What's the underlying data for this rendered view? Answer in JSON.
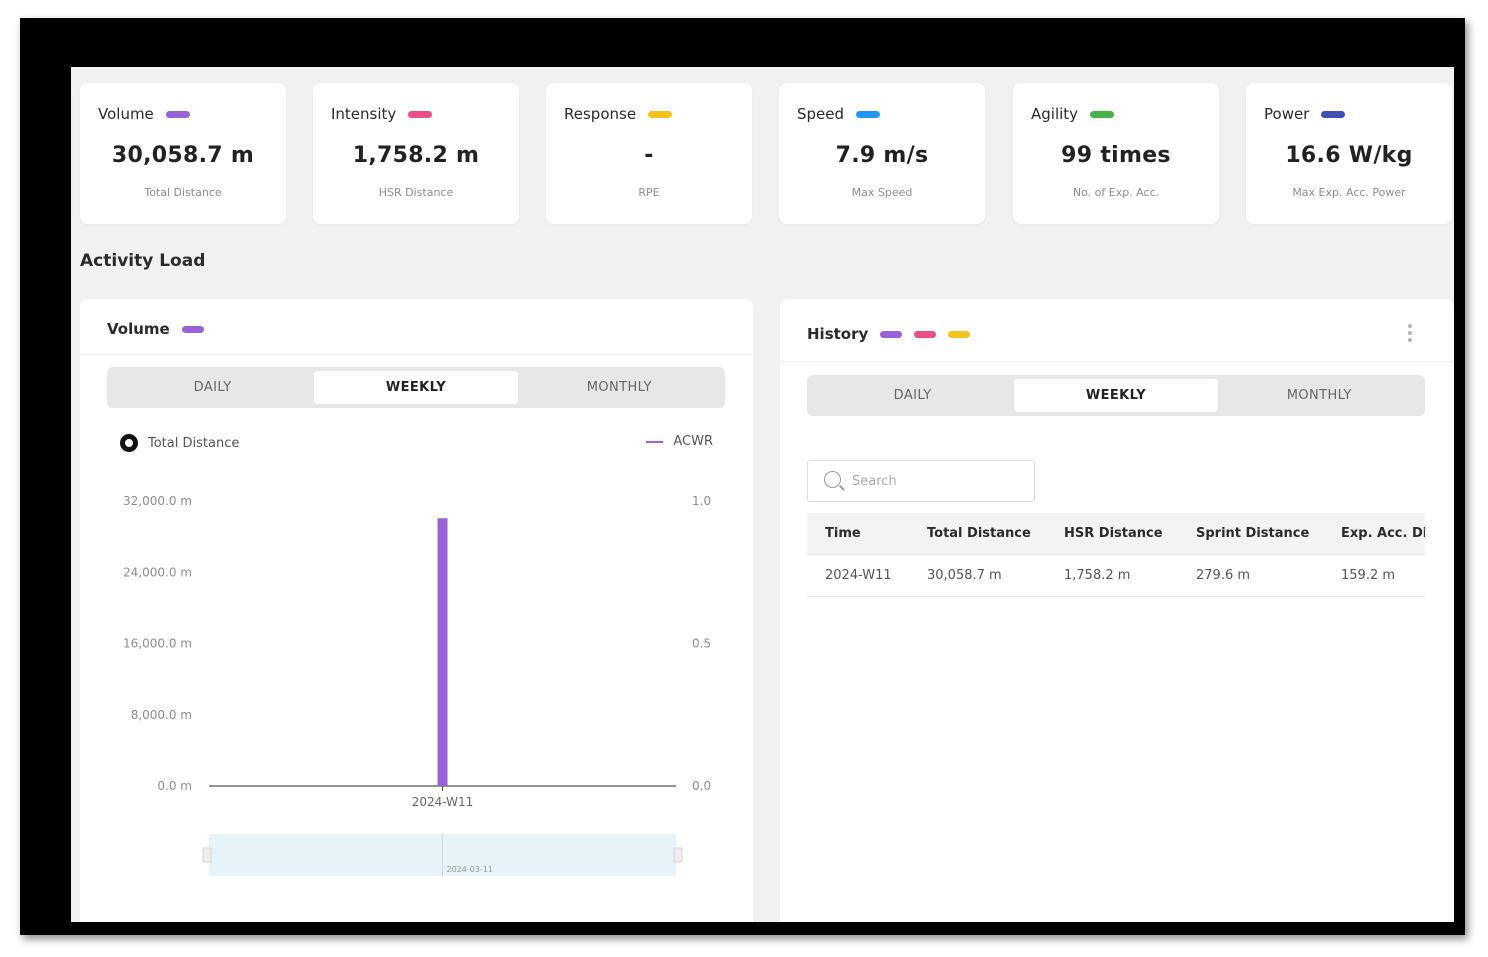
{
  "colors": {
    "volume": "#9a62d8",
    "intensity": "#ea4f8a",
    "response": "#f3c21b",
    "speed": "#2196f3",
    "agility": "#43b34a",
    "power": "#3f51b5"
  },
  "cards": [
    {
      "title": "Volume",
      "value": "30,058.7 m",
      "sub": "Total Distance",
      "color_key": "volume"
    },
    {
      "title": "Intensity",
      "value": "1,758.2 m",
      "sub": "HSR Distance",
      "color_key": "intensity"
    },
    {
      "title": "Response",
      "value": "-",
      "sub": "RPE",
      "color_key": "response"
    },
    {
      "title": "Speed",
      "value": "7.9 m/s",
      "sub": "Max Speed",
      "color_key": "speed"
    },
    {
      "title": "Agility",
      "value": "99 times",
      "sub": "No. of Exp. Acc.",
      "color_key": "agility"
    },
    {
      "title": "Power",
      "value": "16.6 W/kg",
      "sub": "Max Exp. Acc. Power",
      "color_key": "power"
    }
  ],
  "section_title": "Activity Load",
  "volume_panel": {
    "title": "Volume",
    "tabs": [
      "DAILY",
      "WEEKLY",
      "MONTHLY"
    ],
    "active_tab": "WEEKLY",
    "legend_left": "Total Distance",
    "legend_right": "ACWR",
    "zoom_label": "2024-03-11"
  },
  "chart_data": {
    "type": "bar",
    "categories": [
      "2024-W11"
    ],
    "series": [
      {
        "name": "Total Distance",
        "values": [
          30058.7
        ]
      }
    ],
    "ylim": [
      0,
      32000
    ],
    "y_ticks": [
      "32,000.0 m",
      "24,000.0 m",
      "16,000.0 m",
      "8,000.0 m",
      "0.0 m"
    ],
    "y2lim": [
      0,
      1.0
    ],
    "y2_ticks": [
      "1.0",
      "0.5",
      "0.0"
    ],
    "legend": "top",
    "grid": false
  },
  "history_panel": {
    "title": "History",
    "tabs": [
      "DAILY",
      "WEEKLY",
      "MONTHLY"
    ],
    "active_tab": "WEEKLY",
    "search_placeholder": "Search",
    "columns": [
      "Time",
      "Total Distance",
      "HSR Distance",
      "Sprint Distance",
      "Exp. Acc. Distance"
    ],
    "rows": [
      [
        "2024-W11",
        "30,058.7 m",
        "1,758.2 m",
        "279.6 m",
        "159.2 m"
      ]
    ]
  }
}
